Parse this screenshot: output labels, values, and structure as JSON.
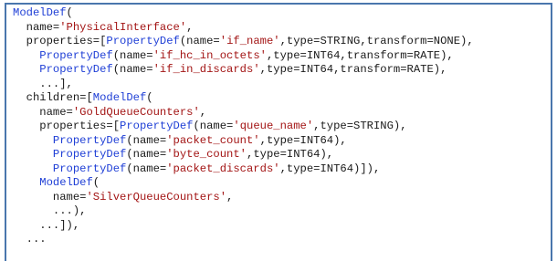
{
  "code": {
    "lines": [
      [
        {
          "t": "ModelDef",
          "c": "kw"
        },
        {
          "t": "(",
          "c": "ok"
        }
      ],
      [
        {
          "t": "  name=",
          "c": "ok"
        },
        {
          "t": "'PhysicalInterface'",
          "c": "str"
        },
        {
          "t": ",",
          "c": "ok"
        }
      ],
      [
        {
          "t": "  properties=[",
          "c": "ok"
        },
        {
          "t": "PropertyDef",
          "c": "kw"
        },
        {
          "t": "(name=",
          "c": "ok"
        },
        {
          "t": "'if_name'",
          "c": "str"
        },
        {
          "t": ",type=STRING,transform=NONE),",
          "c": "ok"
        }
      ],
      [
        {
          "t": "    ",
          "c": "ok"
        },
        {
          "t": "PropertyDef",
          "c": "kw"
        },
        {
          "t": "(name=",
          "c": "ok"
        },
        {
          "t": "'if_hc_in_octets'",
          "c": "str"
        },
        {
          "t": ",type=INT64,transform=RATE),",
          "c": "ok"
        }
      ],
      [
        {
          "t": "    ",
          "c": "ok"
        },
        {
          "t": "PropertyDef",
          "c": "kw"
        },
        {
          "t": "(name=",
          "c": "ok"
        },
        {
          "t": "'if_in_discards'",
          "c": "str"
        },
        {
          "t": ",type=INT64,transform=RATE),",
          "c": "ok"
        }
      ],
      [
        {
          "t": "    ...],",
          "c": "ok"
        }
      ],
      [
        {
          "t": "  children=[",
          "c": "ok"
        },
        {
          "t": "ModelDef",
          "c": "kw"
        },
        {
          "t": "(",
          "c": "ok"
        }
      ],
      [
        {
          "t": "    name=",
          "c": "ok"
        },
        {
          "t": "'GoldQueueCounters'",
          "c": "str"
        },
        {
          "t": ",",
          "c": "ok"
        }
      ],
      [
        {
          "t": "    properties=[",
          "c": "ok"
        },
        {
          "t": "PropertyDef",
          "c": "kw"
        },
        {
          "t": "(name=",
          "c": "ok"
        },
        {
          "t": "'queue_name'",
          "c": "str"
        },
        {
          "t": ",type=STRING),",
          "c": "ok"
        }
      ],
      [
        {
          "t": "      ",
          "c": "ok"
        },
        {
          "t": "PropertyDef",
          "c": "kw"
        },
        {
          "t": "(name=",
          "c": "ok"
        },
        {
          "t": "'packet_count'",
          "c": "str"
        },
        {
          "t": ",type=INT64),",
          "c": "ok"
        }
      ],
      [
        {
          "t": "      ",
          "c": "ok"
        },
        {
          "t": "PropertyDef",
          "c": "kw"
        },
        {
          "t": "(name=",
          "c": "ok"
        },
        {
          "t": "'byte_count'",
          "c": "str"
        },
        {
          "t": ",type=INT64),",
          "c": "ok"
        }
      ],
      [
        {
          "t": "      ",
          "c": "ok"
        },
        {
          "t": "PropertyDef",
          "c": "kw"
        },
        {
          "t": "(name=",
          "c": "ok"
        },
        {
          "t": "'packet_discards'",
          "c": "str"
        },
        {
          "t": ",type=INT64)]),",
          "c": "ok"
        }
      ],
      [
        {
          "t": "    ",
          "c": "ok"
        },
        {
          "t": "ModelDef",
          "c": "kw"
        },
        {
          "t": "(",
          "c": "ok"
        }
      ],
      [
        {
          "t": "      name=",
          "c": "ok"
        },
        {
          "t": "'SilverQueueCounters'",
          "c": "str"
        },
        {
          "t": ",",
          "c": "ok"
        }
      ],
      [
        {
          "t": "      ...),",
          "c": "ok"
        }
      ],
      [
        {
          "t": "    ...]),",
          "c": "ok"
        }
      ],
      [
        {
          "t": "  ...",
          "c": "ok"
        }
      ]
    ]
  },
  "colors": {
    "keyword": "#1f3fd6",
    "string": "#a31515",
    "text": "#1a1a1a",
    "border": "#4a76ad"
  }
}
